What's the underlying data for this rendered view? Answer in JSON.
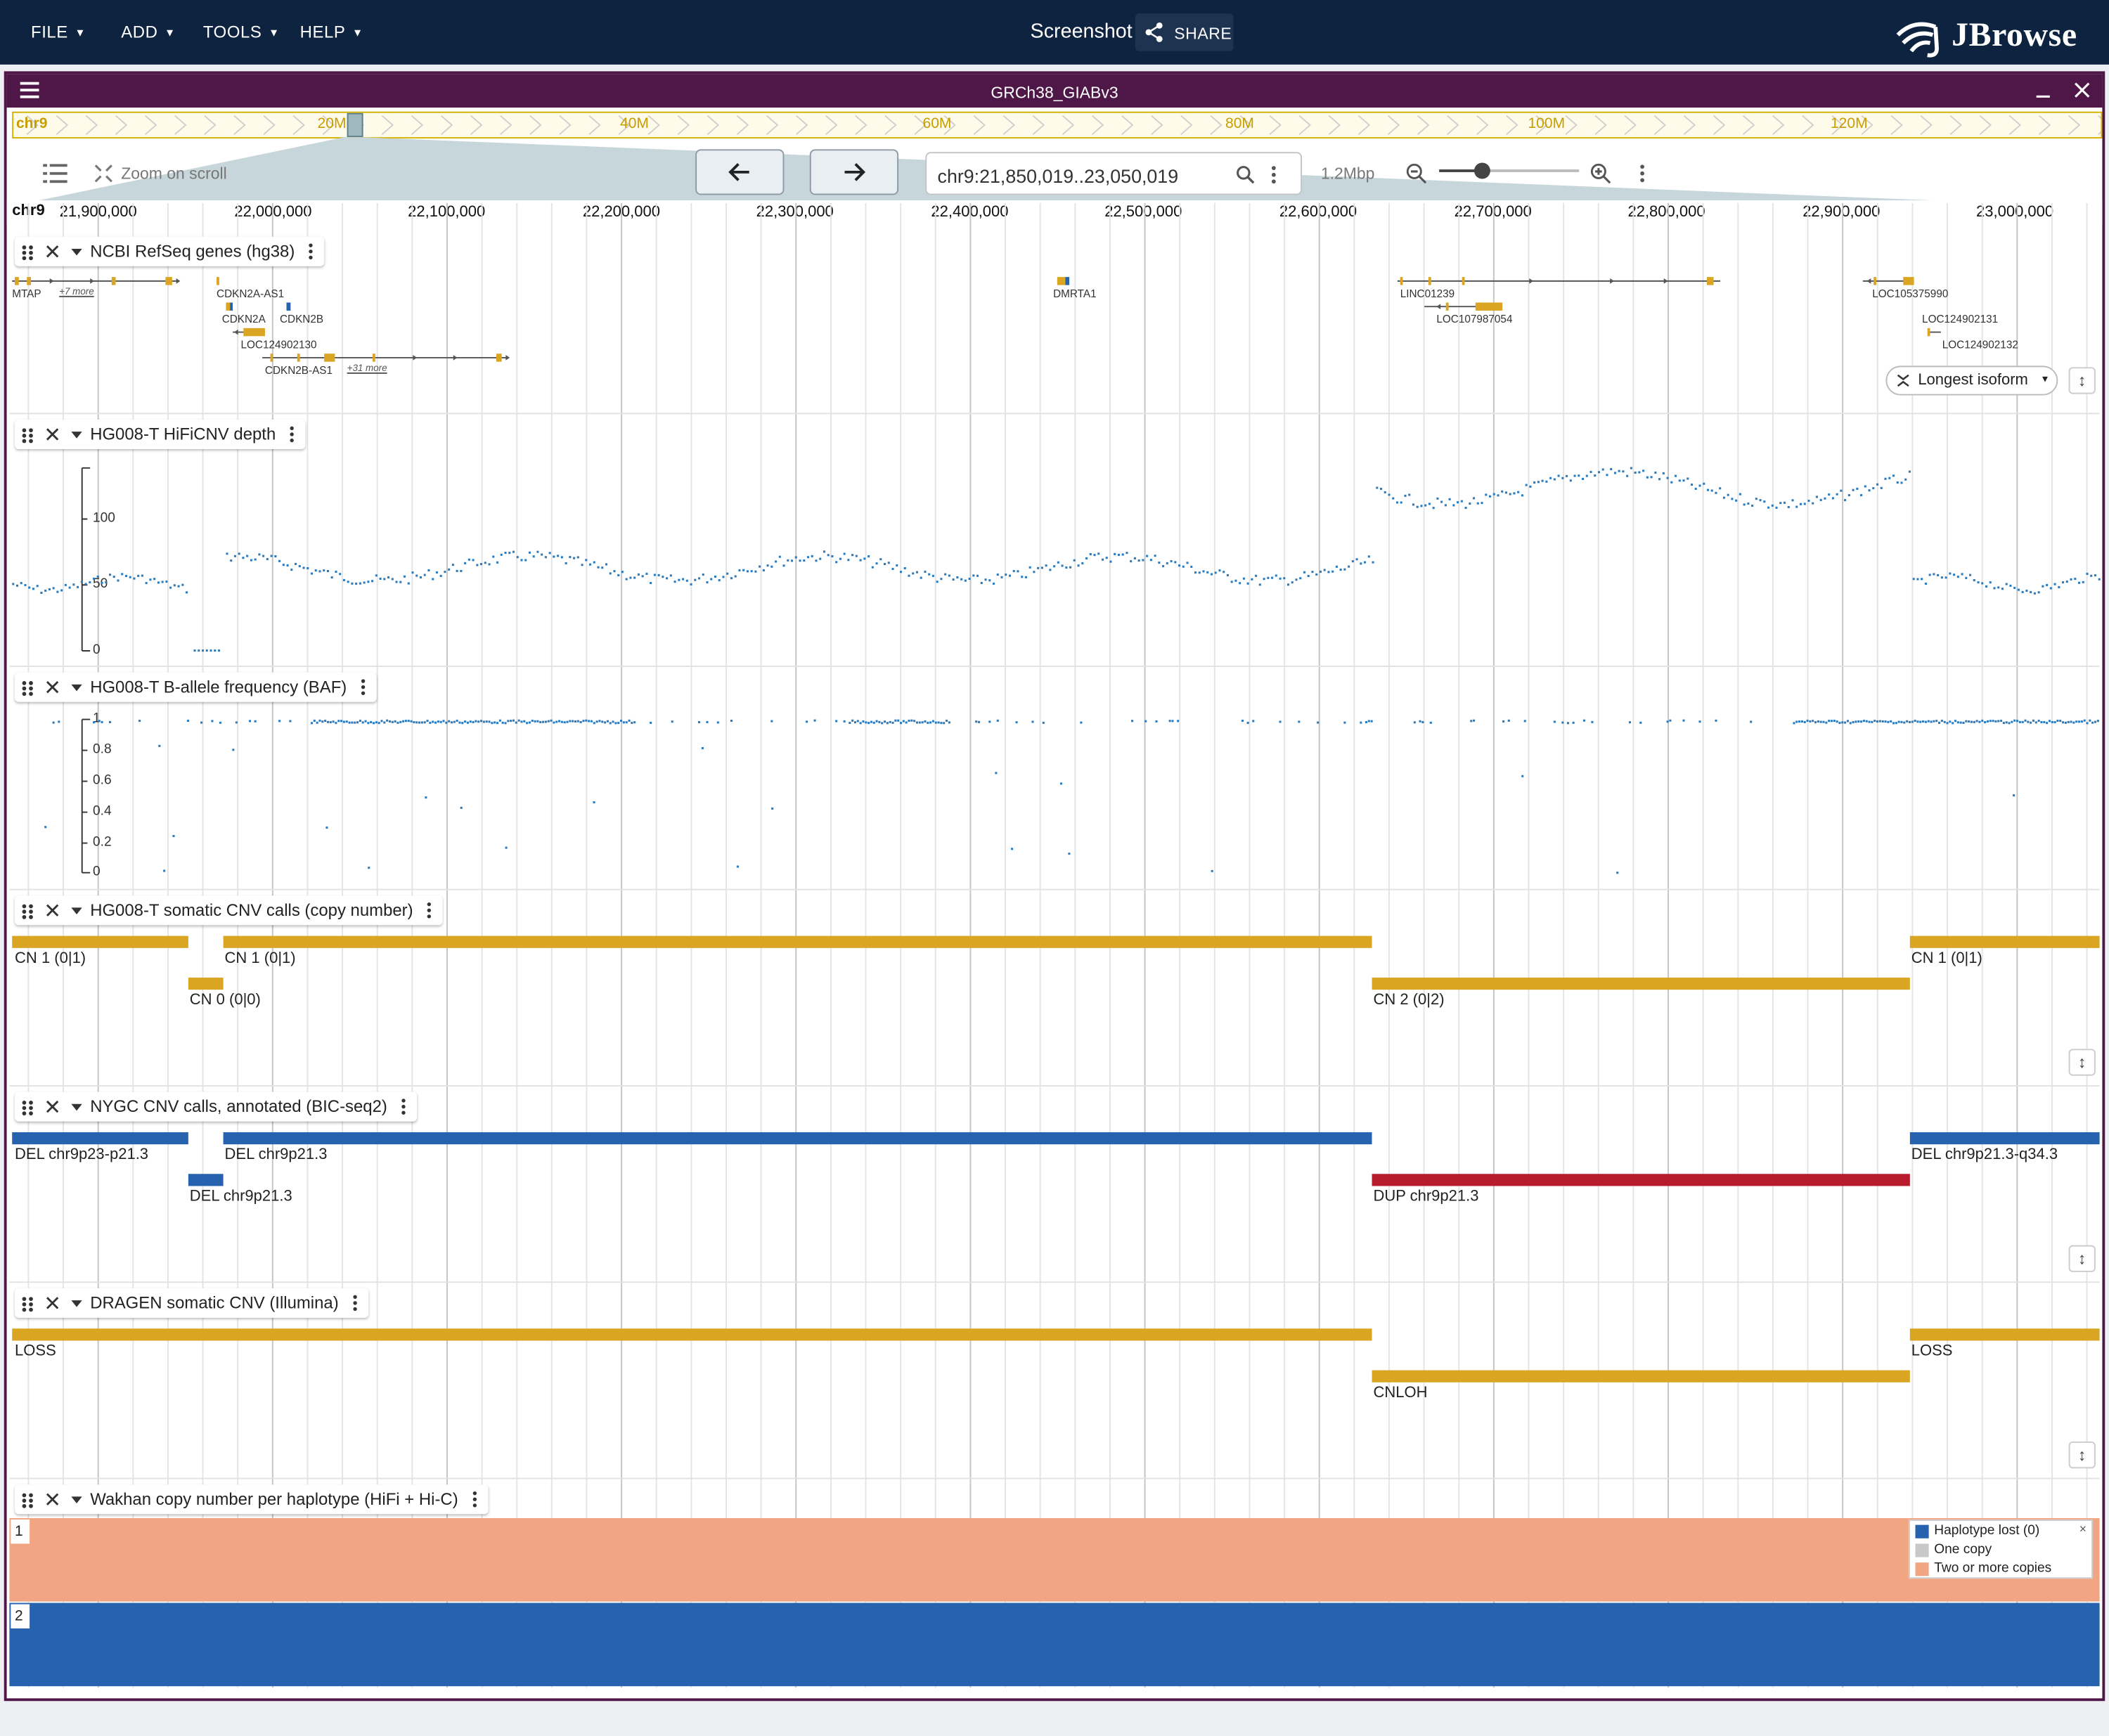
{
  "app": {
    "menus": [
      "FILE",
      "ADD",
      "TOOLS",
      "HELP"
    ],
    "window_title": "Screenshot",
    "share_label": "SHARE",
    "logo_text": "JBrowse"
  },
  "view": {
    "assembly": "GRCh38_GIABv3",
    "overview_chr": "chr9",
    "overview_ticks": [
      "20M",
      "40M",
      "60M",
      "80M",
      "100M",
      "120M"
    ],
    "zoom_on_scroll": "Zoom on scroll",
    "locstring": "chr9:21,850,019..23,050,019",
    "span_label": "1.2Mbp",
    "ruler_chr": "chr9",
    "ruler_ticks": [
      "21,900,000",
      "22,000,000",
      "22,100,000",
      "22,200,000",
      "22,300,000",
      "22,400,000",
      "22,500,000",
      "22,600,000",
      "22,700,000",
      "22,800,000",
      "22,900,000",
      "23,000,000"
    ]
  },
  "tracks": {
    "genes": {
      "name": "NCBI RefSeq genes (hg38)",
      "labels": [
        "MTAP",
        "+7 more",
        "CDKN2A-AS1",
        "CDKN2A",
        "CDKN2B",
        "LOC124902130",
        "CDKN2B-AS1",
        "+31 more",
        "DMRTA1",
        "LINC01239",
        "LOC107987054",
        "LOC105375990",
        "LOC124902131",
        "LOC124902132"
      ],
      "isoform_label": "Longest isoform"
    },
    "depth": {
      "name": "HG008-T HiFiCNV depth",
      "yticks": [
        "100",
        "50",
        "0"
      ]
    },
    "baf": {
      "name": "HG008-T B-allele frequency (BAF)",
      "yticks": [
        "1",
        "0.8",
        "0.6",
        "0.4",
        "0.2",
        "0"
      ]
    },
    "cn": {
      "name": "HG008-T somatic CNV calls (copy number)",
      "labels": [
        "CN 1 (0|1)",
        "CN 1 (0|1)",
        "CN 0 (0|0)",
        "CN 2 (0|2)",
        "CN 1 (0|1)"
      ]
    },
    "nygc": {
      "name": "NYGC CNV calls, annotated (BIC-seq2)",
      "labels": [
        "DEL chr9p23-p21.3",
        "DEL chr9p21.3",
        "DEL chr9p21.3",
        "DUP chr9p21.3",
        "DEL chr9p21.3-q34.3"
      ]
    },
    "dragen": {
      "name": "DRAGEN somatic CNV (Illumina)",
      "labels": [
        "LOSS",
        "CNLOH",
        "LOSS"
      ]
    },
    "wakhan": {
      "name": "Wakhan copy number per haplotype (HiFi + Hi-C)",
      "rows": [
        "1",
        "2"
      ],
      "legend": [
        "Haplotype lost (0)",
        "One copy",
        "Two or more copies"
      ],
      "legend_close": "×",
      "colors": {
        "lost": "#2662ad",
        "one": "#c8c8c8",
        "two": "#f2a582"
      }
    }
  }
}
